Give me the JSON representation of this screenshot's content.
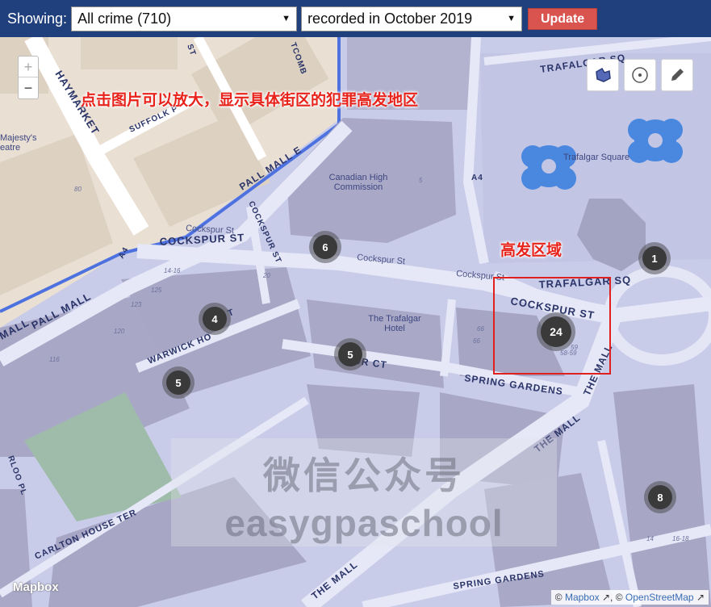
{
  "toolbar": {
    "showing_label": "Showing:",
    "crime_select_value": "All crime (710)",
    "month_select_value": "recorded in October 2019",
    "update_label": "Update",
    "bar_color": "#1f3f7d",
    "update_color": "#d9534f"
  },
  "map": {
    "zoom_in_label": "+",
    "zoom_out_label": "−",
    "tools": [
      {
        "name": "polygon-draw-icon"
      },
      {
        "name": "circle-draw-icon"
      },
      {
        "name": "pencil-icon"
      }
    ],
    "clusters": [
      {
        "count": "6"
      },
      {
        "count": "1"
      },
      {
        "count": "4"
      },
      {
        "count": "24"
      },
      {
        "count": "5"
      },
      {
        "count": "5"
      },
      {
        "count": "8"
      }
    ],
    "street_labels": {
      "haymarket": "HAYMARKET",
      "suffolk": "SUFFOLK P",
      "pall_mall_e": "PALL MALL E",
      "cockspur_st_main": "COCKSPUR ST",
      "cockspur_st_right": "COCKSPUR ST",
      "cockspur_st_vertical": "COCKSPUR ST",
      "cockspur_small_1": "Cockspur St",
      "cockspur_small_2": "Cockspur St",
      "cockspur_small_3": "Cockspur St",
      "trafalgar_sq_top": "TRAFALGAR SQ",
      "trafalgar_sq_mid": "TRAFALGAR SQ",
      "pall_mall": "PALL MALL",
      "mall_left": "MALL",
      "warwick": "WARWICK HO",
      "warwick_suffix": "T",
      "spur_ct": "SPUR CT",
      "spring_gardens_1": "SPRING GARDENS",
      "spring_gardens_2": "SPRING GARDENS",
      "the_mall_1": "THE MALL",
      "the_mall_2": "THE MALL",
      "the_mall_3": "THE MALL",
      "carlton": "CARLTON HOUSE TER",
      "a4_left": "A4",
      "a4_right": "A4",
      "rloo_pl": "RLOO PL",
      "st_top": "ST",
      "tcomb": "TCOMB"
    },
    "place_labels": {
      "canadian_1": "Canadian High",
      "canadian_2": "Commission",
      "majesty_1": "Majesty's",
      "majesty_2": "eatre",
      "trafalgar_square": "Trafalgar Square",
      "hotel_1": "The Trafalgar",
      "hotel_2": "Hotel"
    },
    "house_numbers": [
      "14-16",
      "20",
      "125",
      "123",
      "120",
      "116",
      "80",
      "5",
      "66",
      "66",
      "59",
      "58-59",
      "14",
      "16-18"
    ]
  },
  "annotations": {
    "zoom_hint": "点击图片可以放大，显示具体街区的犯罪高发地区",
    "hotspot": "高发区域"
  },
  "watermark": {
    "line1": "微信公众号",
    "line2": "easygpaschool"
  },
  "attribution": {
    "logo": "Mapbox",
    "prefix": "© ",
    "mapbox_link": "Mapbox",
    "separator": " ↗, © ",
    "osm_link": "OpenStreetMap",
    "suffix": " ↗"
  }
}
